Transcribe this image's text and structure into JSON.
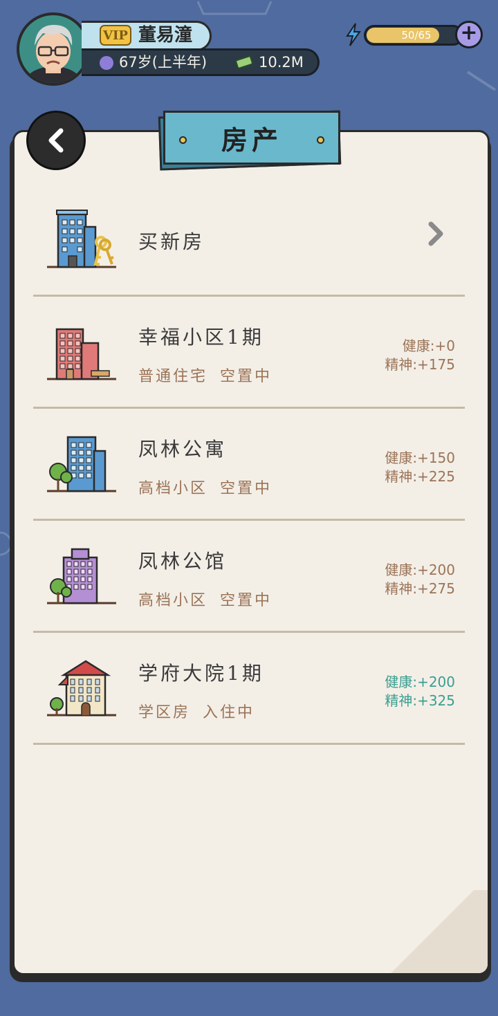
{
  "player": {
    "vip_label": "VIP",
    "name": "董易潼",
    "age": "67岁(上半年)",
    "money": "10.2M"
  },
  "energy": {
    "label": "50/65",
    "current": 50,
    "max": 65
  },
  "header": {
    "title": "房产"
  },
  "buy": {
    "label": "买新房"
  },
  "properties": [
    {
      "name": "幸福小区1期",
      "type": "普通住宅",
      "status": "空置中",
      "health": "健康:+0",
      "spirit": "精神:+175",
      "building_color": "#e07a78",
      "highlight": false
    },
    {
      "name": "凤林公寓",
      "type": "高档小区",
      "status": "空置中",
      "health": "健康:+150",
      "spirit": "精神:+225",
      "building_color": "#5a9ad0",
      "highlight": false
    },
    {
      "name": "凤林公馆",
      "type": "高档小区",
      "status": "空置中",
      "health": "健康:+200",
      "spirit": "精神:+275",
      "building_color": "#b58fd4",
      "highlight": false
    },
    {
      "name": "学府大院1期",
      "type": "学区房",
      "status": "入住中",
      "health": "健康:+200",
      "spirit": "精神:+325",
      "building_color": "#f2e6c8",
      "highlight": true
    }
  ],
  "colors": {
    "background": "#4f6b9f",
    "paper": "#f3efe7",
    "banner": "#6ab8cc",
    "stat_text": "#9b7357",
    "active_stat_text": "#3a9e90"
  }
}
